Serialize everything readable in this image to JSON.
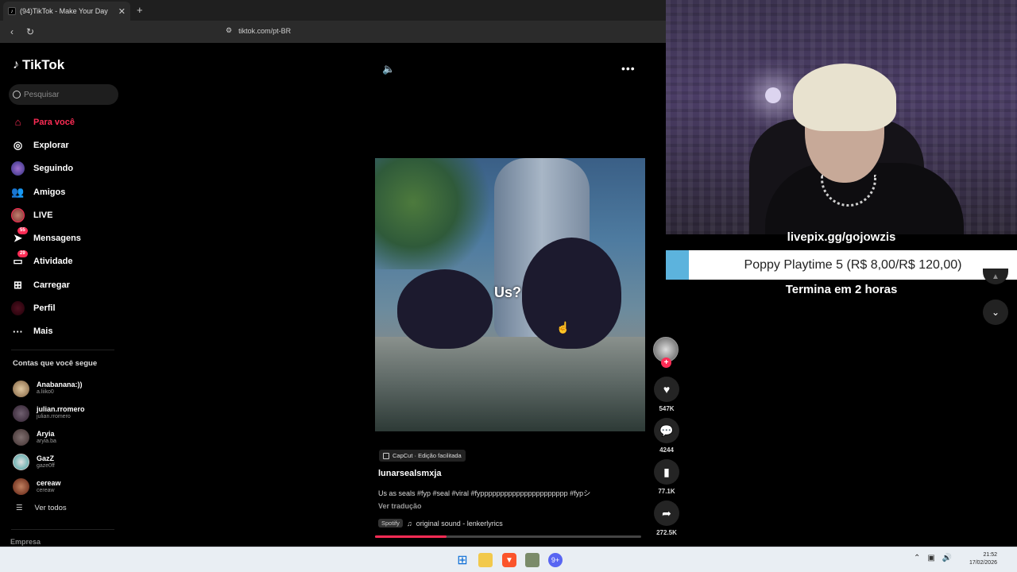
{
  "browser": {
    "tab_title": "(94)TikTok - Make Your Day",
    "tab_favicon": "tiktok-icon",
    "url": "tiktok.com/pt-BR"
  },
  "sidebar": {
    "logo": "TikTok",
    "search_placeholder": "Pesquisar",
    "nav": [
      {
        "label": "Para você",
        "icon": "home-icon"
      },
      {
        "label": "Explorar",
        "icon": "compass-icon"
      },
      {
        "label": "Seguindo",
        "icon": "following-avatar"
      },
      {
        "label": "Amigos",
        "icon": "friends-icon"
      },
      {
        "label": "LIVE",
        "icon": "live-avatar"
      },
      {
        "label": "Mensagens",
        "icon": "send-icon",
        "badge": "55"
      },
      {
        "label": "Atividade",
        "icon": "inbox-icon",
        "badge": "29"
      },
      {
        "label": "Carregar",
        "icon": "upload-icon"
      },
      {
        "label": "Perfil",
        "icon": "profile-avatar"
      },
      {
        "label": "Mais",
        "icon": "more-icon"
      }
    ],
    "following_title": "Contas que você segue",
    "following": [
      {
        "name": "Anabanana:))",
        "handle": "a.liiko0"
      },
      {
        "name": "julian.rromero",
        "handle": "julian.rromero"
      },
      {
        "name": "Aryia",
        "handle": "aryia.ba"
      },
      {
        "name": "GazZ",
        "handle": "gaze0ff"
      },
      {
        "name": "cereaw",
        "handle": "cereaw"
      }
    ],
    "see_all": "Ver todos",
    "company": "Empresa"
  },
  "video": {
    "overlay_text": "Us?",
    "capcut_label": "CapCut · Edição facilitada",
    "author": "lunarsealsmxja",
    "description": "Us as seals #fyp #seal #viral #fypppppppppppppppppppppp #fypシ",
    "translate": "Ver tradução",
    "spotify": "Spotify",
    "sound": "original sound - lenkerlyrics",
    "progress": 0.27
  },
  "actions": {
    "likes": "547K",
    "comments": "4244",
    "saves": "77.1K",
    "shares": "272.5K"
  },
  "stream_overlay": {
    "livepix": "livepix.gg/gojowzis",
    "goal": "Poppy Playtime 5 (R$ 8,00/R$ 120,00)",
    "goal_progress": 0.067,
    "ends": "Termina em 2 horas"
  },
  "taskbar": {
    "time": "21:52",
    "date": "17/02/2026",
    "discord_badge": "9+"
  },
  "colors": {
    "accent": "#fe2c55",
    "goal_bar": "#5cb3dd"
  }
}
